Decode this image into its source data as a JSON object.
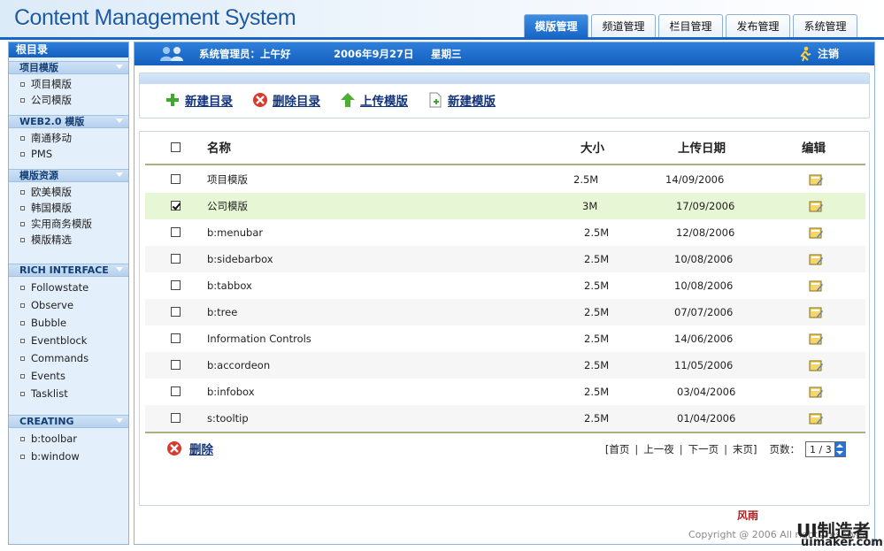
{
  "header": {
    "title": "Content Management System",
    "tabs": [
      "模版管理",
      "频道管理",
      "栏目管理",
      "发布管理",
      "系统管理"
    ],
    "active_tab": 0
  },
  "sidebar": {
    "root": "根目录",
    "groups": [
      {
        "title": "项目模版",
        "items": [
          "项目模版",
          "公司模版"
        ]
      },
      {
        "title": "WEB2.0 模版",
        "items": [
          "南通移动",
          "PMS"
        ]
      },
      {
        "title": "模版资源",
        "items": [
          "欧美模版",
          "韩国模版",
          "实用商务模版",
          "模版精选"
        ]
      },
      {
        "title": "RICH INTERFACE",
        "items": [
          "Followstate",
          "Observe",
          "Bubble",
          "Eventblock",
          "Commands",
          "Events",
          "Tasklist"
        ]
      },
      {
        "title": "CREATING",
        "items": [
          "b:toolbar",
          "b:window"
        ]
      }
    ]
  },
  "bar": {
    "user": "系统管理员：上午好",
    "date": "2006年9月27日",
    "weekday": "星期三",
    "logout": "注销"
  },
  "toolbar": {
    "new_dir": "新建目录",
    "del_dir": "删除目录",
    "upload": "上传模版",
    "new_tpl": "新建模版"
  },
  "table": {
    "headers": {
      "name": "名称",
      "size": "大小",
      "date": "上传日期",
      "edit": "编辑"
    },
    "rows": [
      {
        "name": "项目模版",
        "size": "2.5M",
        "date": "14/09/2006",
        "checked": false
      },
      {
        "name": "公司模版",
        "size": "3M",
        "date": "17/09/2006",
        "checked": true
      },
      {
        "name": "b:menubar",
        "size": "2.5M",
        "date": "12/08/2006",
        "checked": false
      },
      {
        "name": "b:sidebarbox",
        "size": "2.5M",
        "date": "10/08/2006",
        "checked": false
      },
      {
        "name": "b:tabbox",
        "size": "2.5M",
        "date": "10/08/2006",
        "checked": false
      },
      {
        "name": "b:tree",
        "size": "2.5M",
        "date": "07/07/2006",
        "checked": false
      },
      {
        "name": "Information Controls",
        "size": "2.5M",
        "date": "14/06/2006",
        "checked": false
      },
      {
        "name": "b:accordeon",
        "size": "2.5M",
        "date": "11/05/2006",
        "checked": false
      },
      {
        "name": "b:infobox",
        "size": "2.5M",
        "date": "03/04/2006",
        "checked": false
      },
      {
        "name": "s:tooltip",
        "size": "2.5M",
        "date": "01/04/2006",
        "checked": false
      }
    ]
  },
  "footer": {
    "delete": "删除",
    "first": "[首页",
    "prev": "上一夜",
    "next": "下一页",
    "last": "末页]",
    "pages_label": "页数：",
    "page_value": "1 / 3"
  },
  "copyright": "Copyright @ 2006  All rights reserved",
  "watermark": {
    "brand": "风雨",
    "ui": "UI制造者",
    "url": "uimaker.com"
  }
}
